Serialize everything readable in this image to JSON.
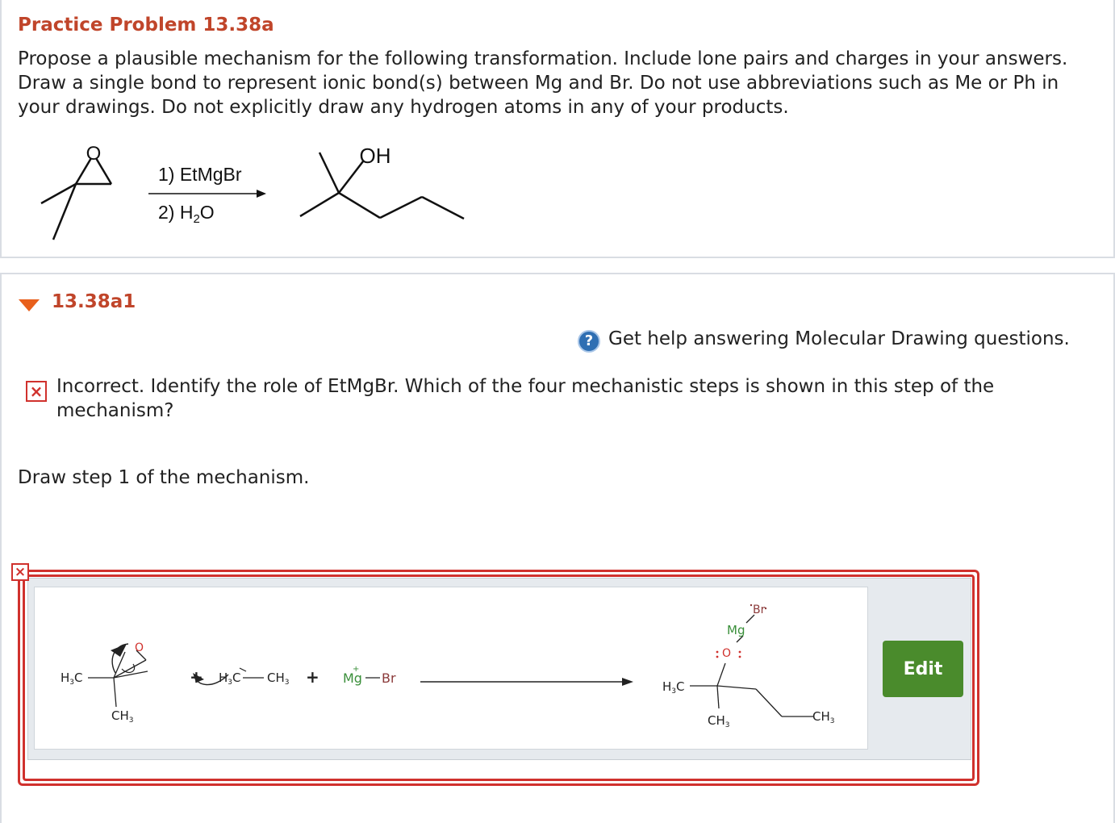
{
  "problem": {
    "title": "Practice Problem 13.38a",
    "text": "Propose a plausible mechanism for the following transformation. Include lone pairs and charges in your answers. Draw a single bond to represent ionic bond(s) between Mg and Br. Do not use abbreviations such as Me or Ph in your drawings. Do not explicitly draw any hydrogen atoms in any of your products."
  },
  "reaction": {
    "reactant_atom": "O",
    "step1": "1) EtMgBr",
    "step2": "2) H",
    "step2_sub": "2",
    "step2_end": "O",
    "product_group": "OH"
  },
  "part": {
    "id": "13.38a1",
    "help_icon": "?",
    "help_text": "Get help answering Molecular Drawing questions.",
    "feedback_mark": "×",
    "feedback": "Incorrect. Identify the role of EtMgBr. Which of the four mechanistic steps is shown in this step of the mechanism?",
    "instruction": "Draw step 1 of the mechanism."
  },
  "drawing": {
    "h3c": "H",
    "sub3": "3",
    "c": "C",
    "ch3": "CH",
    "o": "O",
    "plus": "+",
    "mg": "Mg",
    "br": "Br",
    "mg_charge": "+"
  },
  "answer": {
    "status_mark": "×",
    "edit_label": "Edit"
  },
  "colors": {
    "title": "#c0452a",
    "error": "#d0312d",
    "edit": "#4a8b2c",
    "oxygen": "#d0312d",
    "magnesium": "#3a8f3a",
    "bromine": "#8b3a3a"
  }
}
